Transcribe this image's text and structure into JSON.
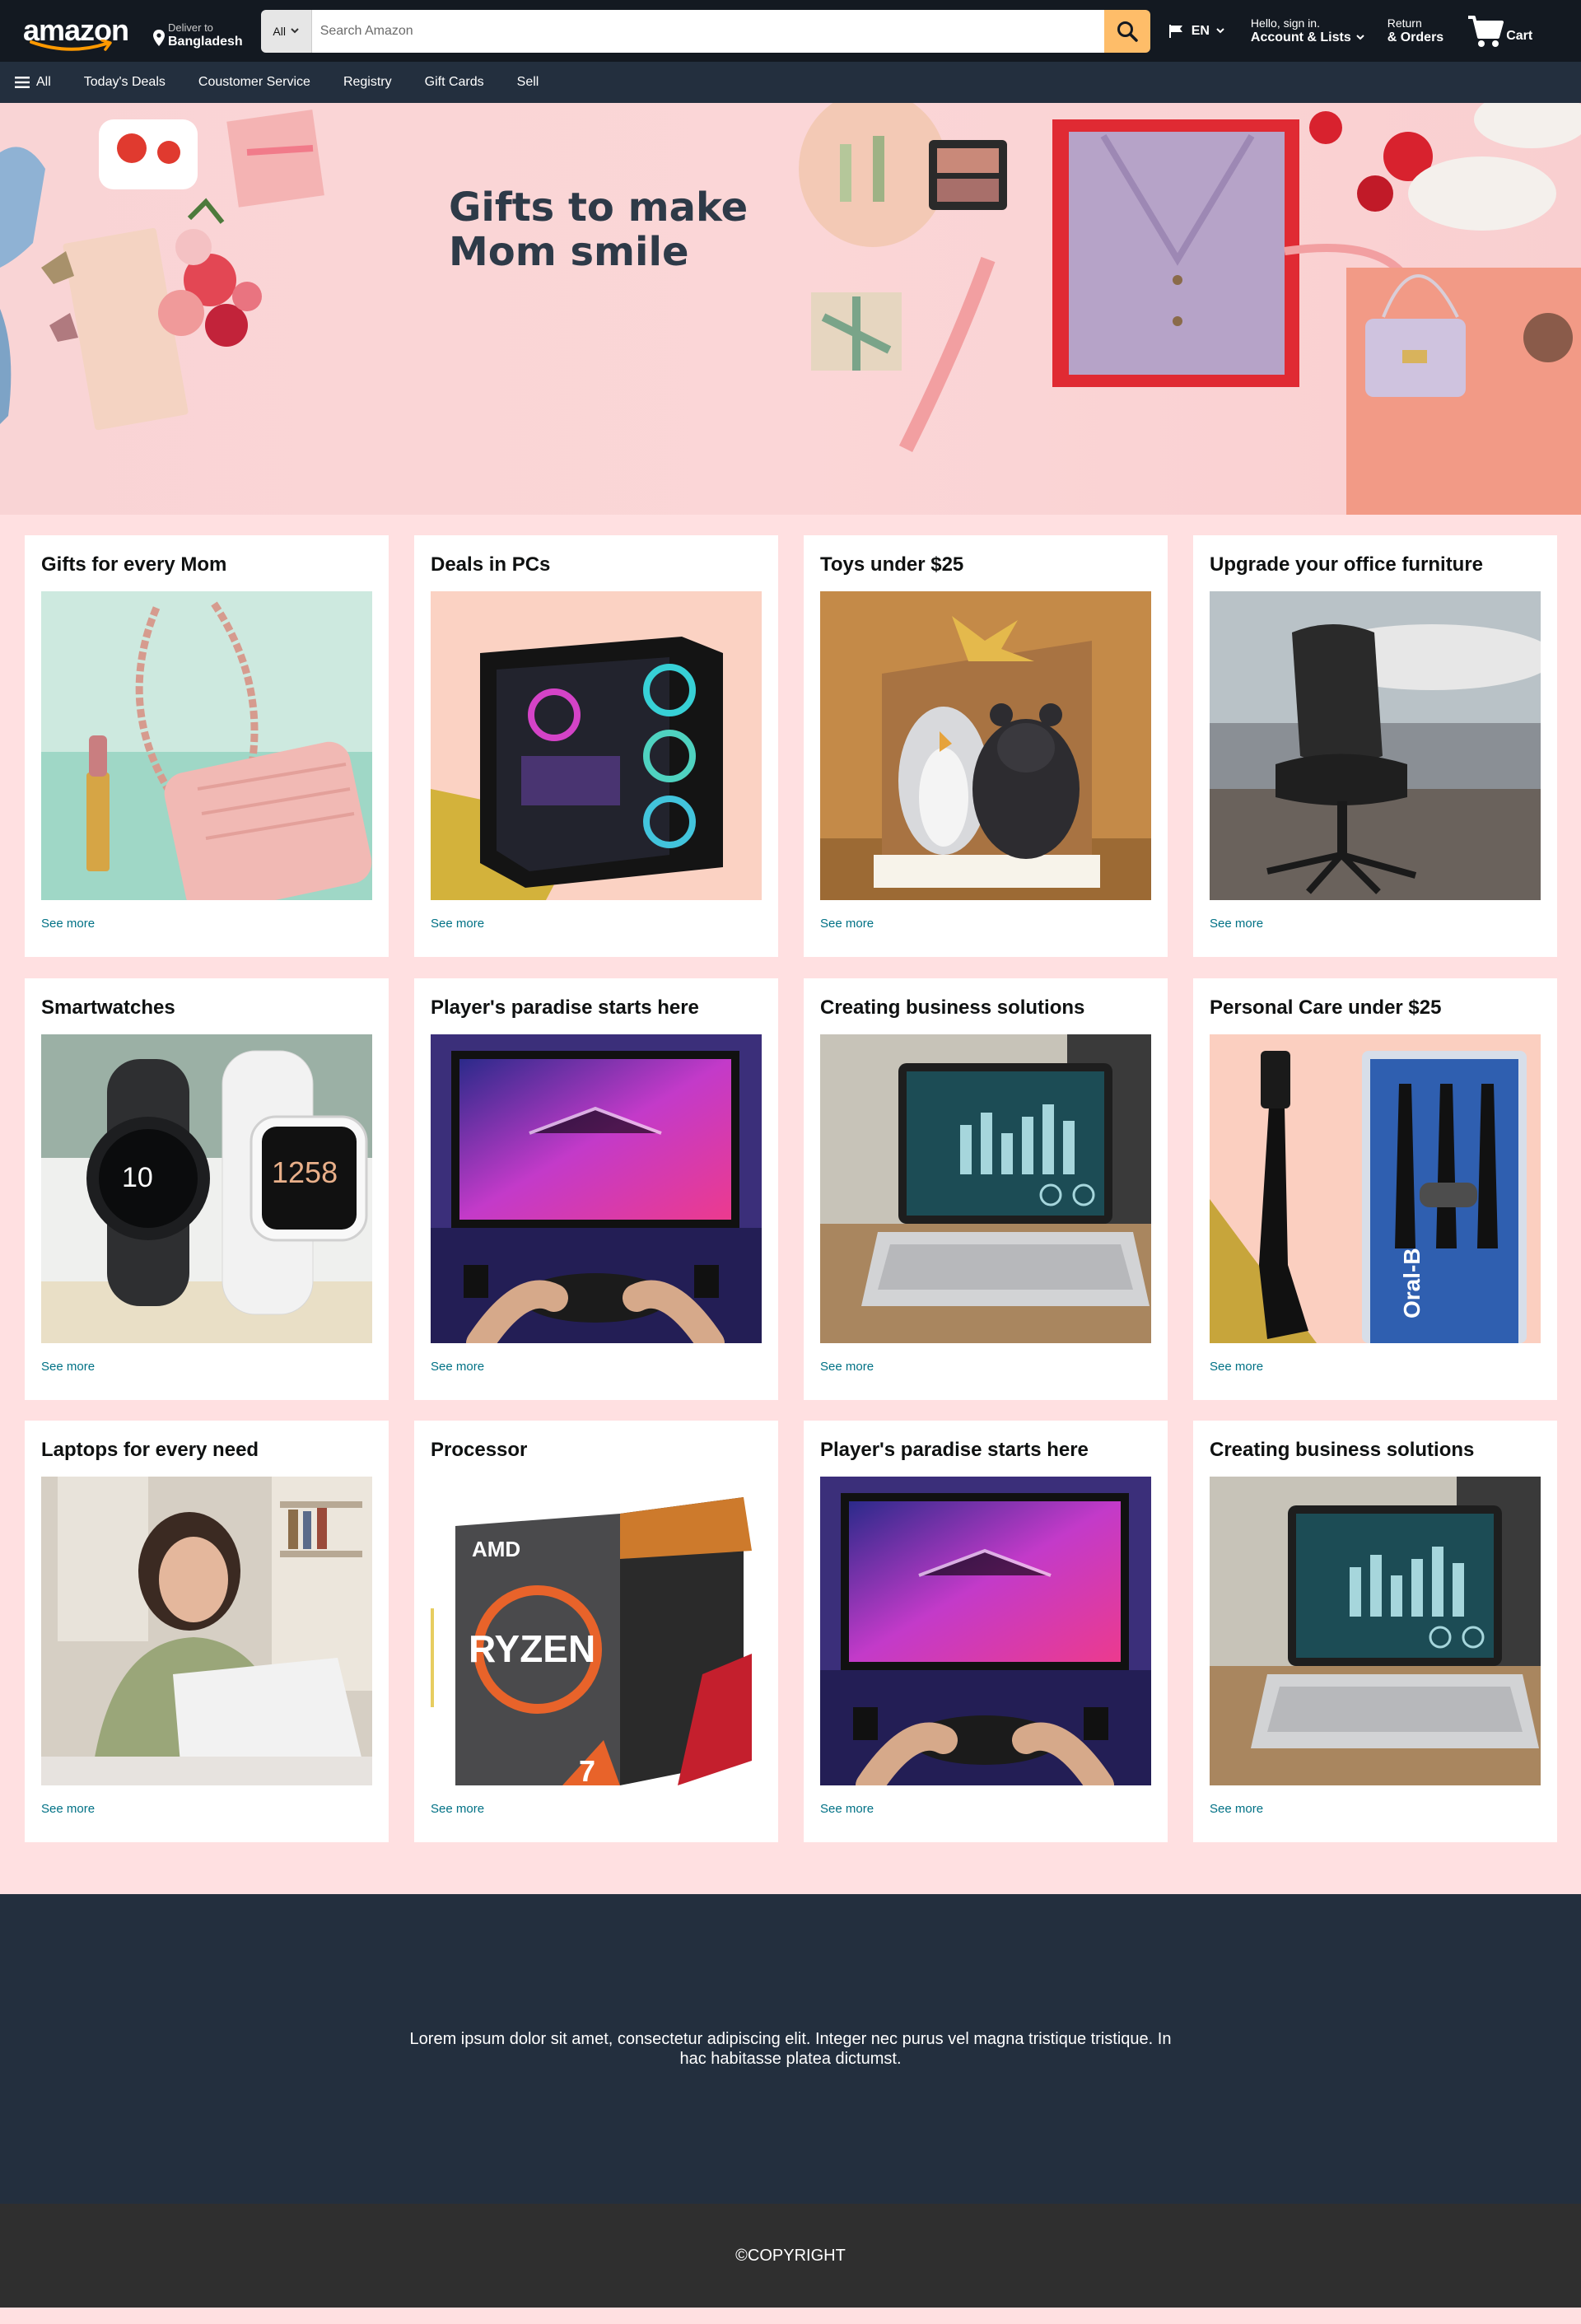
{
  "header": {
    "logo_text": "amazon",
    "deliver_small": "Deliver to",
    "deliver_location": "Bangladesh",
    "search_category": "All",
    "search_placeholder": "Search Amazon",
    "language": "EN",
    "account_small": "Hello, sign in.",
    "account_label": "Account & Lists",
    "returns_small": "Return",
    "returns_label": "& Orders",
    "cart_label": "Cart"
  },
  "subnav": {
    "all_label": "All",
    "items": [
      "Today's Deals",
      "Coustomer Service",
      "Registry",
      "Gift Cards",
      "Sell"
    ]
  },
  "hero": {
    "title_line1": "Gifts to make",
    "title_line2": "Mom smile"
  },
  "cards": [
    {
      "title": "Gifts for every Mom",
      "link": "See more"
    },
    {
      "title": "Deals in PCs",
      "link": "See more"
    },
    {
      "title": "Toys under $25",
      "link": "See more"
    },
    {
      "title": "Upgrade your office furniture",
      "link": "See more"
    },
    {
      "title": "Smartwatches",
      "link": "See more"
    },
    {
      "title": "Player's paradise starts here",
      "link": "See more"
    },
    {
      "title": "Creating business solutions",
      "link": "See more"
    },
    {
      "title": "Personal Care under $25",
      "link": "See more"
    },
    {
      "title": "Laptops for every need",
      "link": "See more"
    },
    {
      "title": "Processor",
      "link": "See more"
    },
    {
      "title": "Player's paradise starts here",
      "link": "See more"
    },
    {
      "title": "Creating business solutions",
      "link": "See more"
    }
  ],
  "product_text": {
    "watch_time_1": "10",
    "watch_time_2": "1258",
    "cpu_brand": "AMD",
    "cpu_name": "RYZEN",
    "cpu_tier": "7",
    "toothbrush_brand": "Oral-B"
  },
  "footer": {
    "text": "Lorem ipsum dolor sit amet, consectetur adipiscing elit. Integer nec purus vel magna tristique tristique. In hac habitasse platea dictumst.",
    "copyright": "©COPYRIGHT"
  },
  "colors": {
    "header_bg": "#131921",
    "subnav_bg": "#232f3e",
    "search_button": "#febd69",
    "link": "#007185",
    "page_bg": "#ffe0e1"
  }
}
